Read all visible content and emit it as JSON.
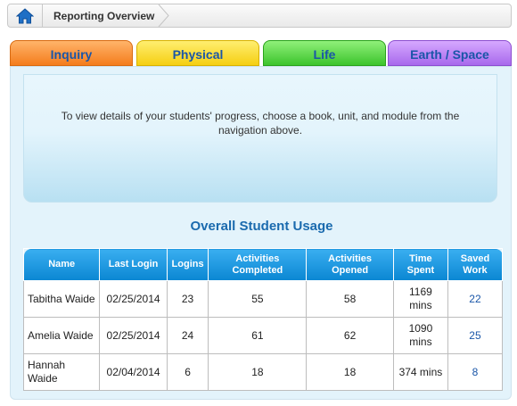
{
  "breadcrumb": {
    "home_icon": "home-icon",
    "title": "Reporting Overview"
  },
  "tabs": [
    {
      "label": "Inquiry",
      "color": "#f47c1c"
    },
    {
      "label": "Physical",
      "color": "#f5cf12"
    },
    {
      "label": "Life",
      "color": "#3cc42c"
    },
    {
      "label": "Earth / Space",
      "color": "#a869ec"
    }
  ],
  "info": {
    "text": "To view details of your students' progress, choose a book, unit, and module from the navigation above."
  },
  "usage": {
    "title": "Overall Student Usage",
    "columns": [
      "Name",
      "Last Login",
      "Logins",
      "Activities Completed",
      "Activities Opened",
      "Time Spent",
      "Saved Work"
    ],
    "rows": [
      {
        "name": "Tabitha Waide",
        "last_login": "02/25/2014",
        "logins": "23",
        "completed": "55",
        "opened": "58",
        "time": "1169 mins",
        "saved": "22"
      },
      {
        "name": "Amelia Waide",
        "last_login": "02/25/2014",
        "logins": "24",
        "completed": "61",
        "opened": "62",
        "time": "1090 mins",
        "saved": "25"
      },
      {
        "name": "Hannah Waide",
        "last_login": "02/04/2014",
        "logins": "6",
        "completed": "18",
        "opened": "18",
        "time": "374 mins",
        "saved": "8"
      }
    ]
  }
}
